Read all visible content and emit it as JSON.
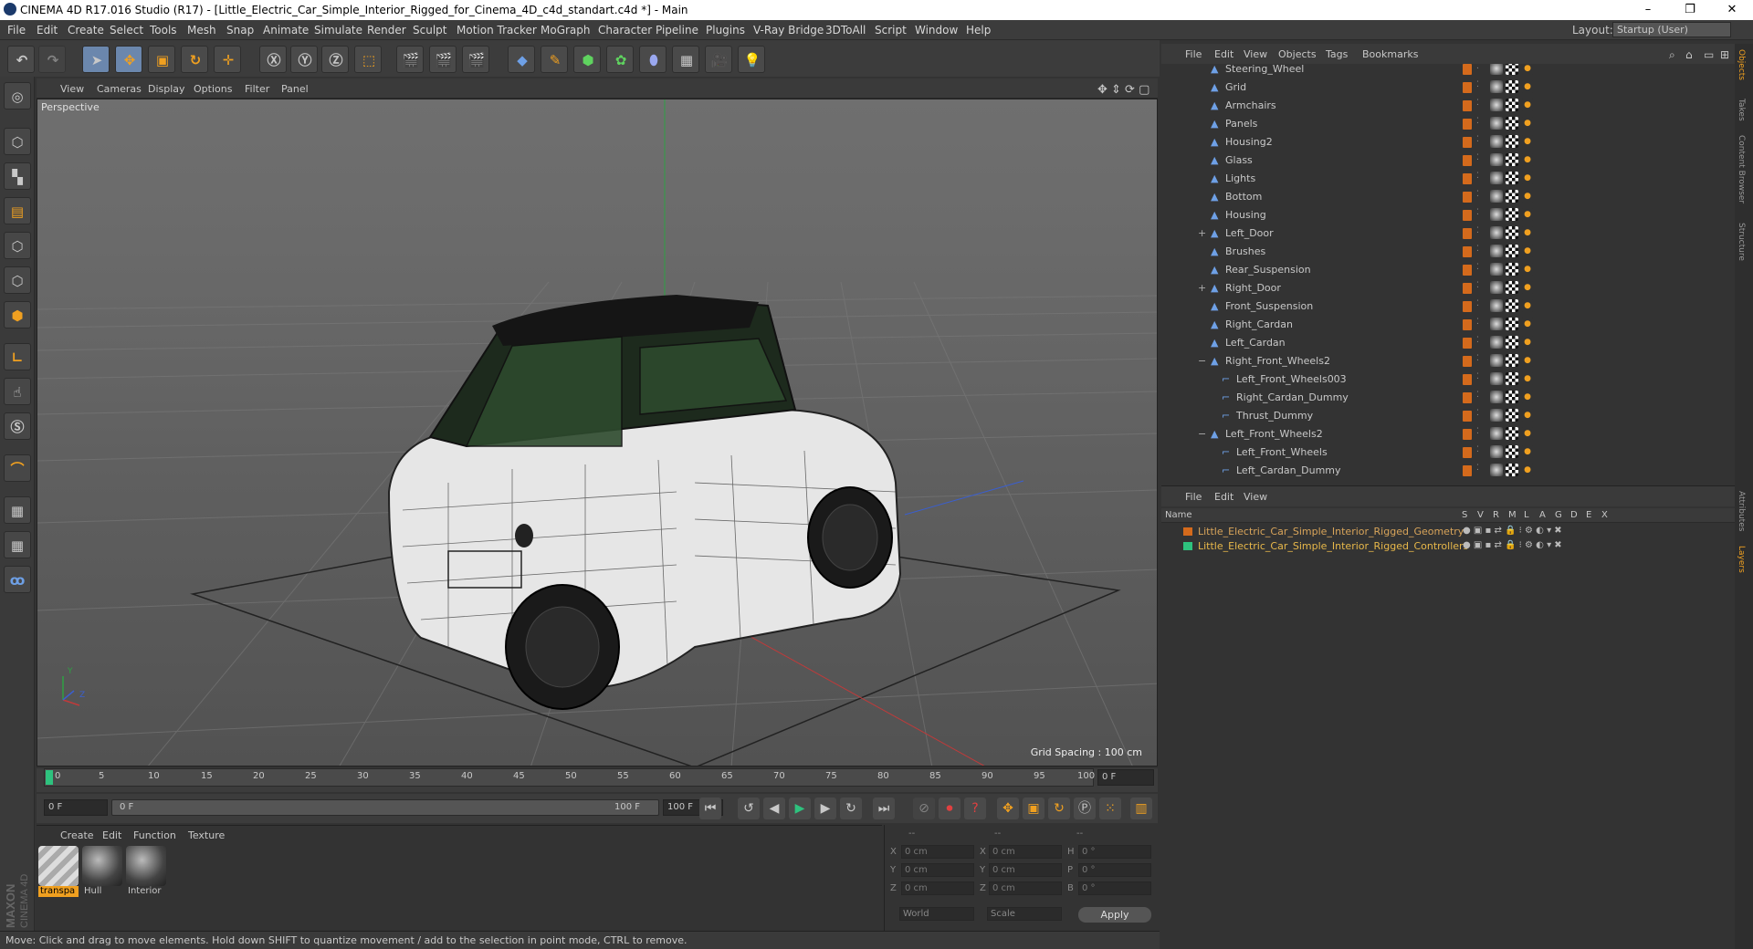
{
  "window": {
    "title": "CINEMA 4D R17.016 Studio (R17) - [Little_Electric_Car_Simple_Interior_Rigged_for_Cinema_4D_c4d_standart.c4d *] - Main",
    "min": "–",
    "max": "❐",
    "close": "✕"
  },
  "menu": [
    "File",
    "Edit",
    "Create",
    "Select",
    "Tools",
    "Mesh",
    "Snap",
    "Animate",
    "Simulate",
    "Render",
    "Sculpt",
    "Motion Tracker",
    "MoGraph",
    "Character",
    "Pipeline",
    "Plugins",
    "V-Ray Bridge",
    "3DToAll",
    "Script",
    "Window",
    "Help"
  ],
  "layout": {
    "label": "Layout:",
    "value": "Startup (User)"
  },
  "viewport": {
    "menu": [
      "View",
      "Cameras",
      "Display",
      "Options",
      "Filter",
      "Panel"
    ],
    "label": "Perspective",
    "grid_spacing": "Grid Spacing : 100 cm",
    "axis_y": "Y",
    "axis_z": "Z"
  },
  "timeline": {
    "ticks": [
      "0",
      "5",
      "10",
      "15",
      "20",
      "25",
      "30",
      "35",
      "40",
      "45",
      "50",
      "55",
      "60",
      "65",
      "70",
      "75",
      "80",
      "85",
      "90",
      "95",
      "100"
    ],
    "end_field": "0 F"
  },
  "transport": {
    "start": "0 F",
    "range_start": "0 F",
    "range_end": "100 F",
    "end": "100 F"
  },
  "materials": {
    "menu": [
      "Create",
      "Edit",
      "Function",
      "Texture"
    ],
    "items": [
      {
        "name": "transpa"
      },
      {
        "name": "Hull"
      },
      {
        "name": "Interior"
      }
    ]
  },
  "coords": {
    "headers": [
      "--",
      "--",
      "--"
    ],
    "rows": [
      {
        "a": "X",
        "av": "0 cm",
        "b": "X",
        "bv": "0 cm",
        "c": "H",
        "cv": "0 °"
      },
      {
        "a": "Y",
        "av": "0 cm",
        "b": "Y",
        "bv": "0 cm",
        "c": "P",
        "cv": "0 °"
      },
      {
        "a": "Z",
        "av": "0 cm",
        "b": "Z",
        "bv": "0 cm",
        "c": "B",
        "cv": "0 °"
      }
    ],
    "space": "World",
    "mode": "Scale",
    "apply": "Apply"
  },
  "status": "Move: Click and drag to move elements. Hold down SHIFT to quantize movement / add to the selection in point mode, CTRL to remove.",
  "objects": {
    "menu": [
      "File",
      "Edit",
      "View",
      "Objects",
      "Tags",
      "Bookmarks"
    ],
    "rows": [
      {
        "name": "Steering_Wheel",
        "indent": 0,
        "exp": ""
      },
      {
        "name": "Grid",
        "indent": 0,
        "exp": ""
      },
      {
        "name": "Armchairs",
        "indent": 0,
        "exp": ""
      },
      {
        "name": "Panels",
        "indent": 0,
        "exp": ""
      },
      {
        "name": "Housing2",
        "indent": 0,
        "exp": ""
      },
      {
        "name": "Glass",
        "indent": 0,
        "exp": ""
      },
      {
        "name": "Lights",
        "indent": 0,
        "exp": ""
      },
      {
        "name": "Bottom",
        "indent": 0,
        "exp": ""
      },
      {
        "name": "Housing",
        "indent": 0,
        "exp": ""
      },
      {
        "name": "Left_Door",
        "indent": 0,
        "exp": "+"
      },
      {
        "name": "Brushes",
        "indent": 0,
        "exp": ""
      },
      {
        "name": "Rear_Suspension",
        "indent": 0,
        "exp": ""
      },
      {
        "name": "Right_Door",
        "indent": 0,
        "exp": "+"
      },
      {
        "name": "Front_Suspension",
        "indent": 0,
        "exp": ""
      },
      {
        "name": "Right_Cardan",
        "indent": 0,
        "exp": ""
      },
      {
        "name": "Left_Cardan",
        "indent": 0,
        "exp": ""
      },
      {
        "name": "Right_Front_Wheels2",
        "indent": 0,
        "exp": "−"
      },
      {
        "name": "Left_Front_Wheels003",
        "indent": 1,
        "exp": ""
      },
      {
        "name": "Right_Cardan_Dummy",
        "indent": 1,
        "exp": ""
      },
      {
        "name": "Thrust_Dummy",
        "indent": 1,
        "exp": ""
      },
      {
        "name": "Left_Front_Wheels2",
        "indent": 0,
        "exp": "−"
      },
      {
        "name": "Left_Front_Wheels",
        "indent": 1,
        "exp": ""
      },
      {
        "name": "Left_Cardan_Dummy",
        "indent": 1,
        "exp": ""
      }
    ]
  },
  "layers": {
    "menu": [
      "File",
      "Edit",
      "View"
    ],
    "headers": [
      "Name",
      "S",
      "V",
      "R",
      "M",
      "L",
      "A",
      "G",
      "D",
      "E",
      "X"
    ],
    "rows": [
      {
        "name": "Little_Electric_Car_Simple_Interior_Rigged_Geometry",
        "color": "#d46a1c"
      },
      {
        "name": "Little_Electric_Car_Simple_Interior_Rigged_Controllers",
        "color": "#2ec27e"
      }
    ]
  },
  "side_tabs": [
    "Objects",
    "Takes",
    "Content Browser",
    "Structure",
    "Attributes",
    "Layers"
  ],
  "brand": {
    "line1": "MAXON",
    "line2": "CINEMA 4D"
  }
}
